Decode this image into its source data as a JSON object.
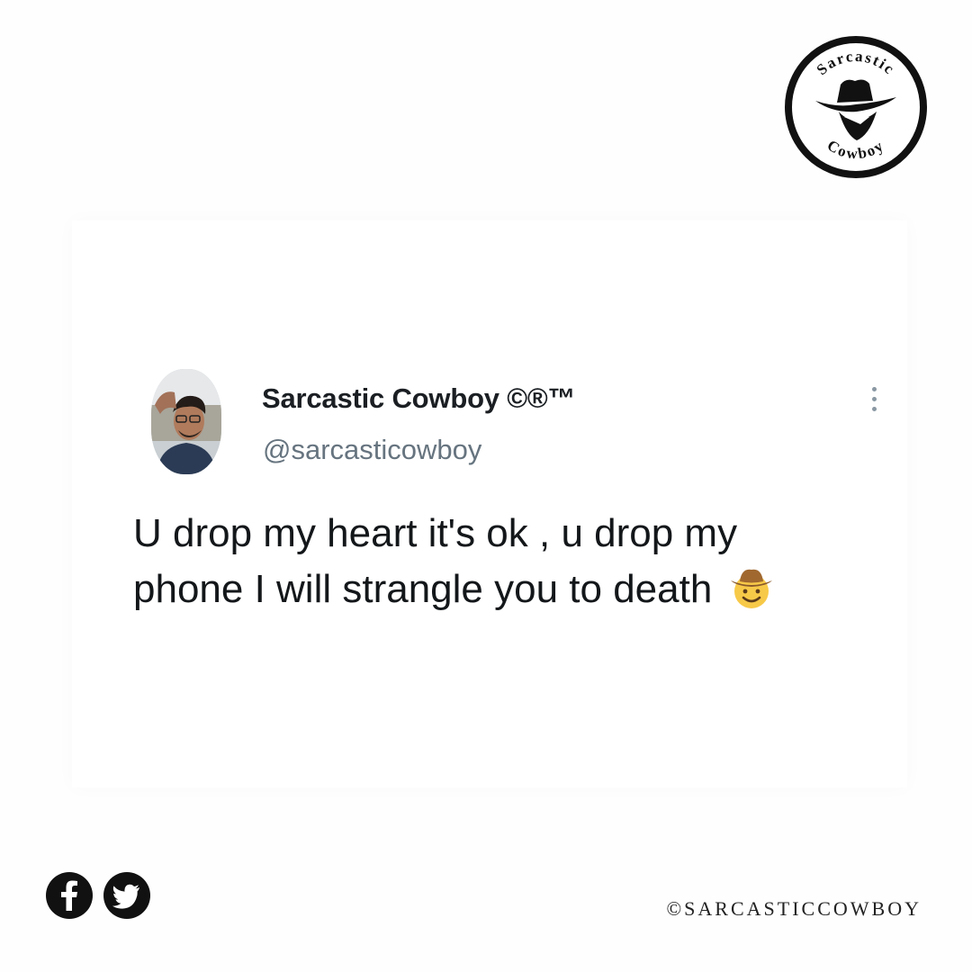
{
  "brand": {
    "logo_top_text": "Sarcastic",
    "logo_bottom_text": "Cowboy"
  },
  "tweet": {
    "display_name": "Sarcastic Cowboy ©®™",
    "handle": "@sarcasticowboy",
    "text_lines": [
      "U drop my heart it's ok , u drop my",
      "phone I will strangle you to death"
    ],
    "emoji": "cowboy-hat-face"
  },
  "footer": {
    "icons": [
      "facebook-icon",
      "twitter-icon"
    ],
    "copyright": "©SARCASTICCOWBOY"
  }
}
